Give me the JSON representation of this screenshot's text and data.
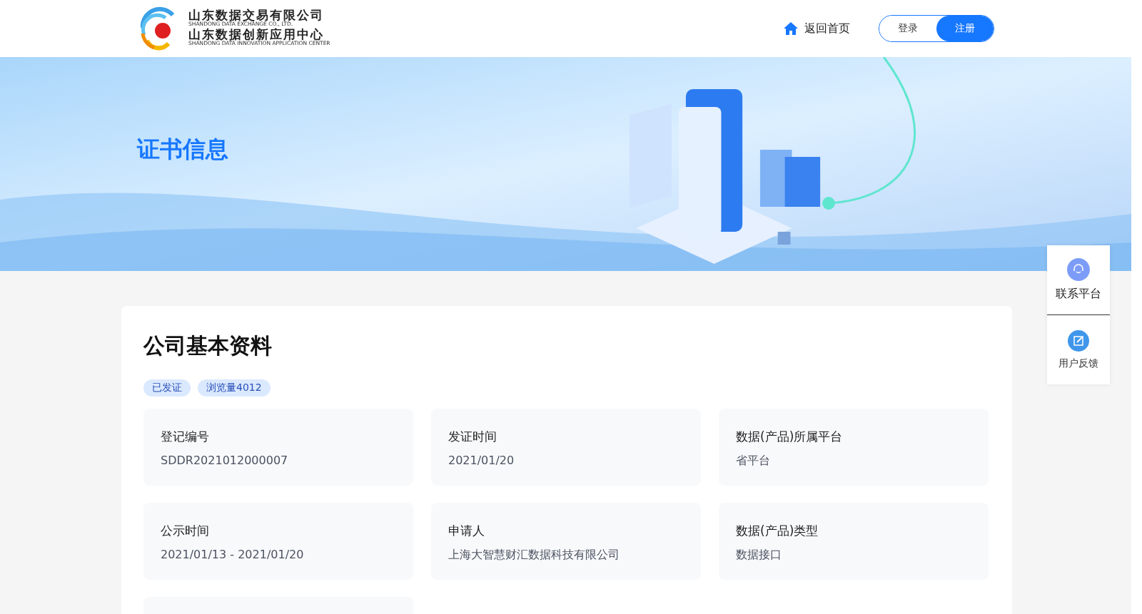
{
  "header": {
    "logo_lines": [
      {
        "cn": "山东数据交易有限公司",
        "en": "SHANDONG DATA EXCHANGE CO., LTD."
      },
      {
        "cn": "山东数据创新应用中心",
        "en": "SHANDONG DATA INNOVATION APPLICATION CENTER"
      }
    ],
    "home_link": "返回首页",
    "auth": [
      {
        "label": "登录",
        "selected": false
      },
      {
        "label": "注册",
        "selected": true
      }
    ]
  },
  "banner": {
    "title": "证书信息",
    "kind": "picture"
  },
  "section": {
    "title": "公司基本资料",
    "tags": [
      "已发证",
      "浏览量4012"
    ],
    "fields": [
      {
        "label": "登记编号",
        "value": "SDDR2021012000007"
      },
      {
        "label": "发证时间",
        "value": "2021/01/20"
      },
      {
        "label": "数据(产品)所属平台",
        "value": "省平台"
      },
      {
        "label": "公示时间",
        "value": "2021/01/13 - 2021/01/20"
      },
      {
        "label": "申请人",
        "value": "上海大智慧财汇数据科技有限公司"
      },
      {
        "label": "数据(产品)类型",
        "value": "数据接口"
      }
    ],
    "more_cards_below": true
  },
  "float_menu": [
    {
      "label": "联系平台",
      "kind": "headset"
    },
    {
      "label": "用户反馈",
      "kind": "edit"
    }
  ]
}
